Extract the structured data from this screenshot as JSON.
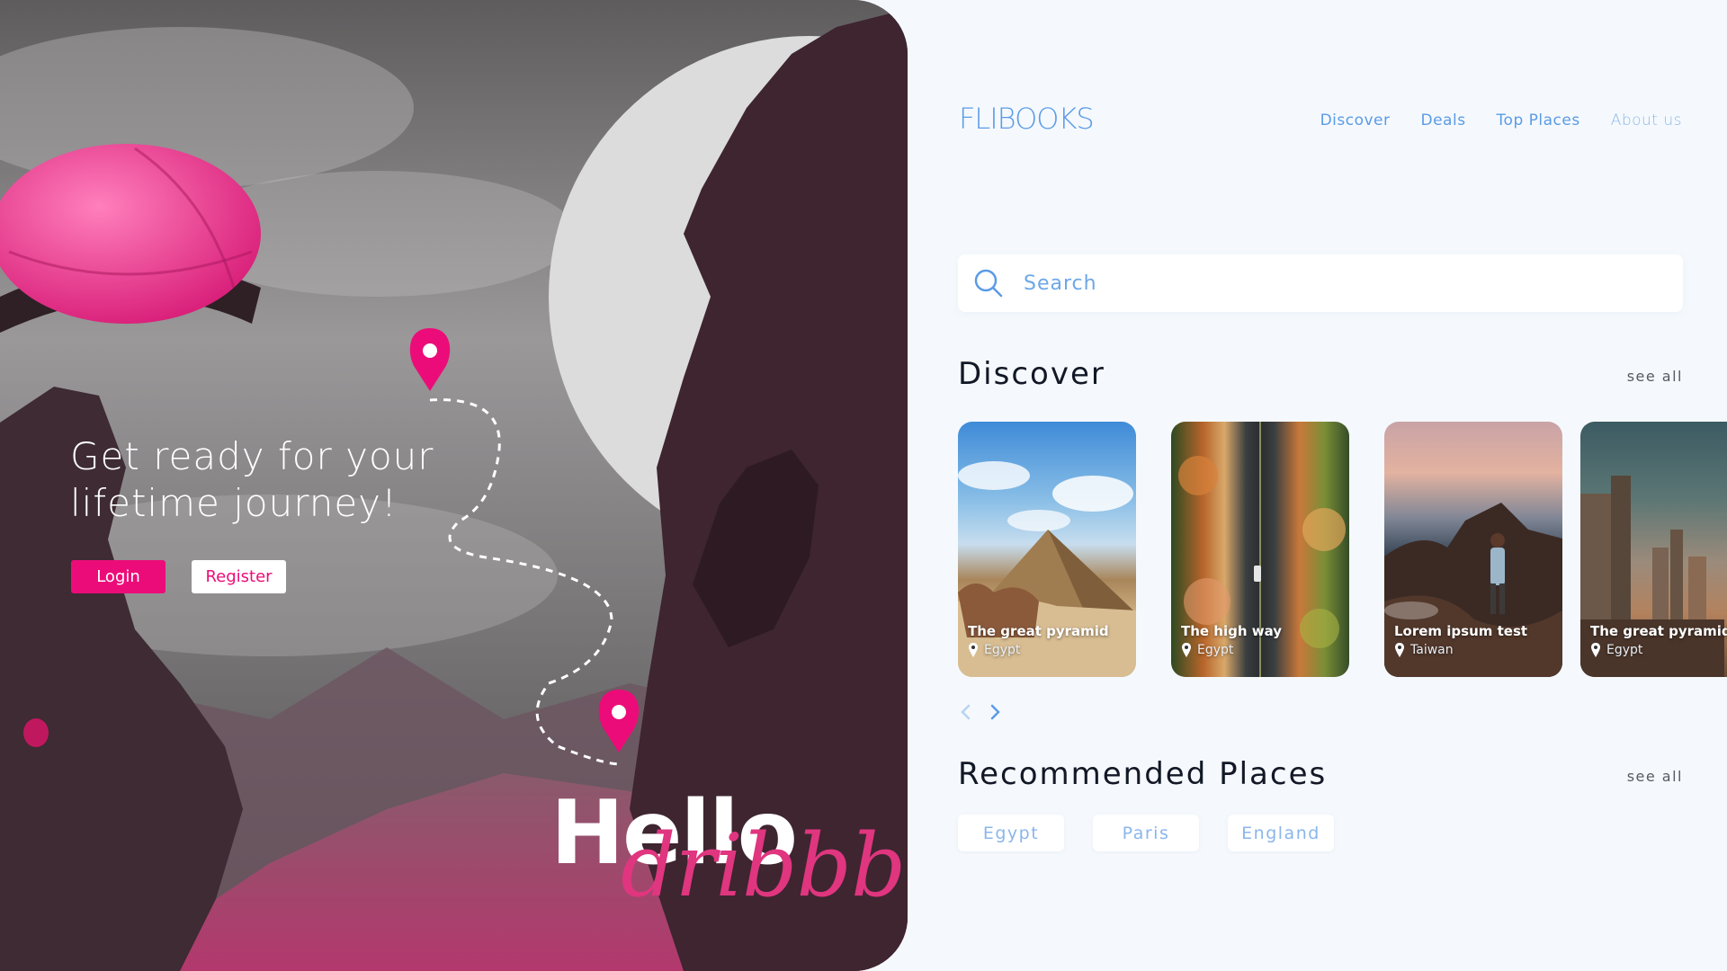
{
  "hero": {
    "tagline": "Get ready for your lifetime journey!",
    "login_label": "Login",
    "register_label": "Register",
    "hello_text": "Hello",
    "dribbble_text": "dribbble"
  },
  "header": {
    "logo": "FLIBOOKS",
    "nav": [
      "Discover",
      "Deals",
      "Top Places",
      "About us"
    ]
  },
  "search": {
    "placeholder": "Search"
  },
  "discover": {
    "title": "Discover",
    "see_all": "see all",
    "cards": [
      {
        "title": "The great pyramid",
        "location": "Egypt"
      },
      {
        "title": "The high way",
        "location": "Egypt"
      },
      {
        "title": "Lorem ipsum test",
        "location": "Taiwan"
      },
      {
        "title": "The great pyramid",
        "location": "Egypt"
      }
    ]
  },
  "recommended": {
    "title": "Recommended Places",
    "see_all": "see all",
    "places": [
      "Egypt",
      "Paris",
      "England"
    ]
  },
  "colors": {
    "accent_pink": "#ec0c79",
    "accent_blue": "#5b9be6",
    "background": "#f5f9fd"
  }
}
